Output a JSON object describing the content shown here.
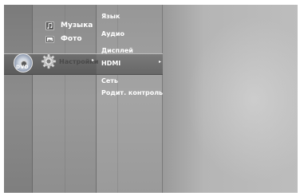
{
  "disc": {
    "label": "DVD"
  },
  "main_menu": {
    "items": [
      {
        "label": "Музыка",
        "icon": "music-note-icon"
      },
      {
        "label": "Фото",
        "icon": "photo-icon"
      }
    ],
    "active": {
      "label": "Настройки",
      "icon": "gear-icon",
      "arrow": "▸"
    }
  },
  "submenu": {
    "items": [
      {
        "label": "Язык"
      },
      {
        "label": "Аудио"
      },
      {
        "label": "Дисплей"
      },
      {
        "label": "HDMI"
      },
      {
        "label": "Сеть"
      },
      {
        "label": "Родит. контроль"
      }
    ],
    "selected_index": 3,
    "arrow": "▸"
  },
  "colors": {
    "text": "#ffffff",
    "selection_bar": "#5f5f5f",
    "background": "#a5a5a5"
  }
}
